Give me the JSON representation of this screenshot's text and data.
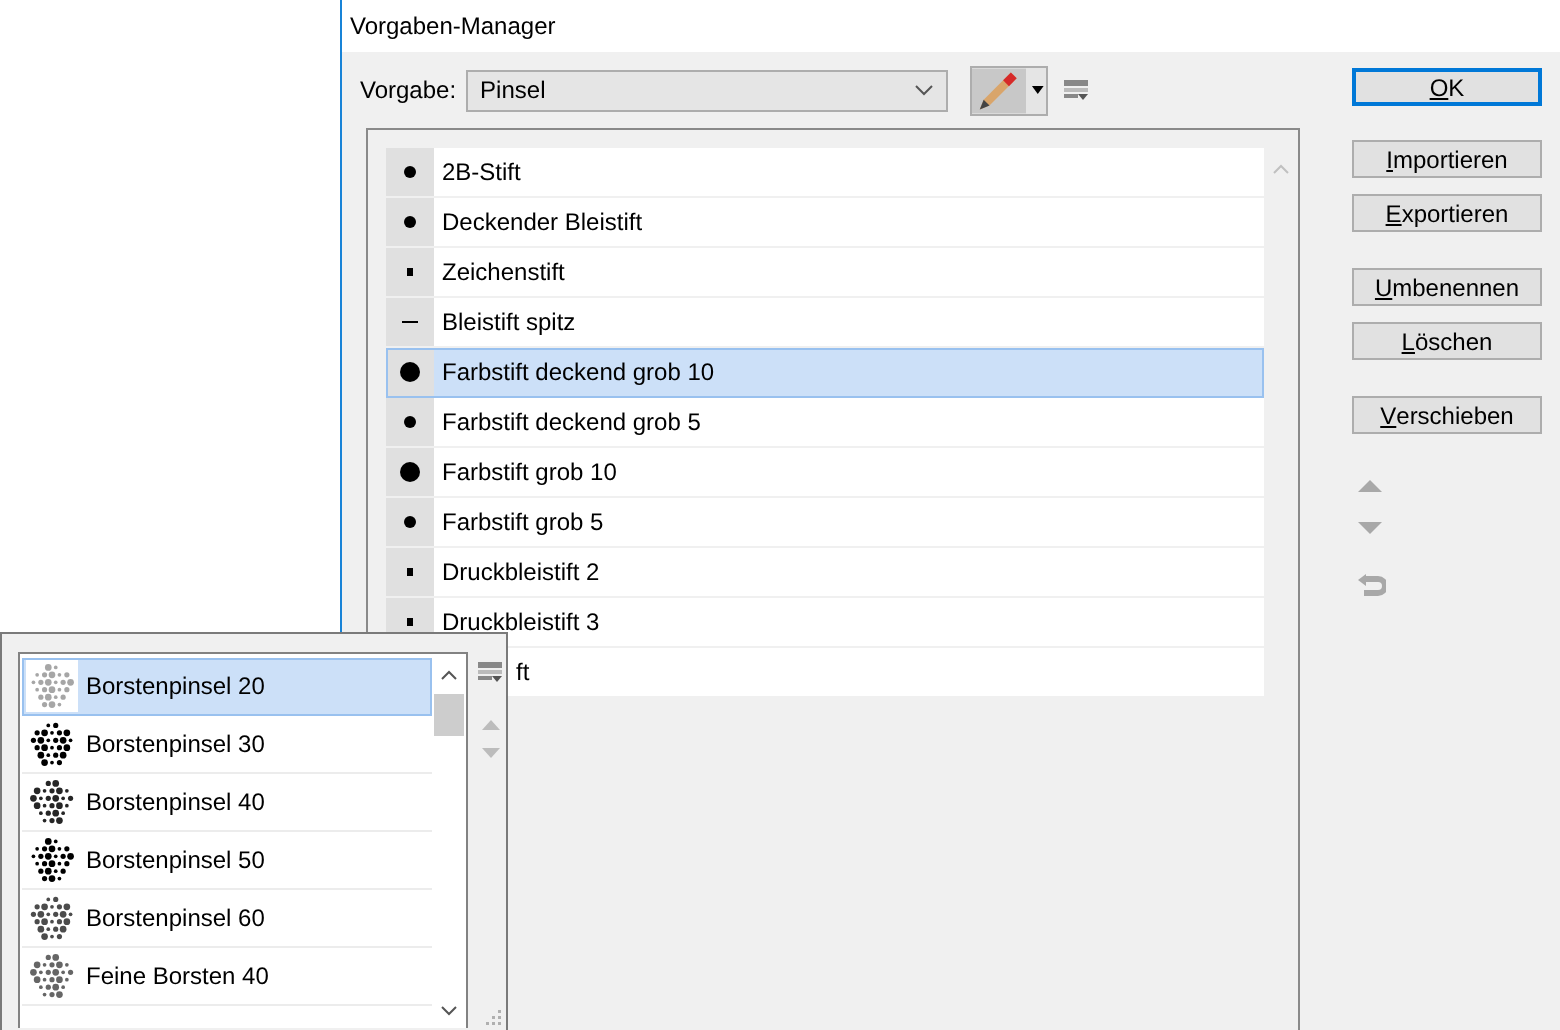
{
  "window": {
    "title": "Vorgaben-Manager"
  },
  "preset": {
    "label": "Vorgabe:",
    "value": "Pinsel"
  },
  "list": [
    {
      "name": "2B-Stift",
      "kind": "dot-m",
      "selected": false
    },
    {
      "name": "Deckender Bleistift",
      "kind": "dot-m",
      "selected": false
    },
    {
      "name": "Zeichenstift",
      "kind": "square",
      "selected": false
    },
    {
      "name": "Bleistift spitz",
      "kind": "dash",
      "selected": false
    },
    {
      "name": "Farbstift deckend grob 10",
      "kind": "dot-l",
      "selected": true
    },
    {
      "name": "Farbstift deckend grob 5",
      "kind": "dot-m",
      "selected": false
    },
    {
      "name": "Farbstift grob 10",
      "kind": "dot-l",
      "selected": false
    },
    {
      "name": "Farbstift grob 5",
      "kind": "dot-m",
      "selected": false
    },
    {
      "name": "Druckbleistift 2",
      "kind": "square",
      "selected": false
    },
    {
      "name": "Druckbleistift 3",
      "kind": "square",
      "selected": false
    },
    {
      "name": "ft",
      "kind": "covered",
      "selected": false
    }
  ],
  "buttons": [
    {
      "label": "OK",
      "default": true
    },
    {
      "label": "Importieren",
      "default": false
    },
    {
      "label": "Exportieren",
      "default": false
    },
    {
      "label": "Umbenennen",
      "default": false
    },
    {
      "label": "Löschen",
      "default": false
    },
    {
      "label": "Verschieben",
      "default": false
    }
  ],
  "popup": {
    "items": [
      {
        "name": "Borstenpinsel 20",
        "selected": true
      },
      {
        "name": "Borstenpinsel 30",
        "selected": false
      },
      {
        "name": "Borstenpinsel 40",
        "selected": false
      },
      {
        "name": "Borstenpinsel 50",
        "selected": false
      },
      {
        "name": "Borstenpinsel 60",
        "selected": false
      },
      {
        "name": "Feine Borsten 40",
        "selected": false
      }
    ]
  }
}
